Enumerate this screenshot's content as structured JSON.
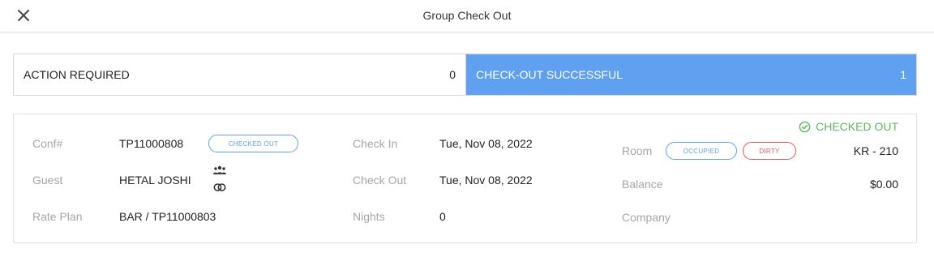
{
  "header": {
    "title": "Group Check Out",
    "close_icon": "close-icon"
  },
  "tabs": [
    {
      "label": "ACTION REQUIRED",
      "count": "0",
      "active": false
    },
    {
      "label": "CHECK-OUT SUCCESSFUL",
      "count": "1",
      "active": true
    }
  ],
  "reservation": {
    "status_label": "CHECKED OUT",
    "status_icon": "check-circle-icon",
    "conf_label": "Conf#",
    "conf_value": "TP11000808",
    "conf_badge": "CHECKED OUT",
    "guest_label": "Guest",
    "guest_value": "HETAL JOSHI",
    "guest_icons": [
      "group-icon",
      "link-icon"
    ],
    "rate_plan_label": "Rate Plan",
    "rate_plan_value": "BAR / TP11000803",
    "check_in_label": "Check In",
    "check_in_value": "Tue, Nov 08, 2022",
    "check_out_label": "Check Out",
    "check_out_value": "Tue, Nov 08, 2022",
    "nights_label": "Nights",
    "nights_value": "0",
    "room_label": "Room",
    "room_badges": [
      "OCCUPIED",
      "DIRTY"
    ],
    "room_value": "KR - 210",
    "balance_label": "Balance",
    "balance_value": "$0.00",
    "company_label": "Company",
    "company_value": ""
  },
  "colors": {
    "accent": "#5fa0f0",
    "success": "#5cb85c",
    "danger": "#e05a5a",
    "label": "#a6a6a6"
  }
}
